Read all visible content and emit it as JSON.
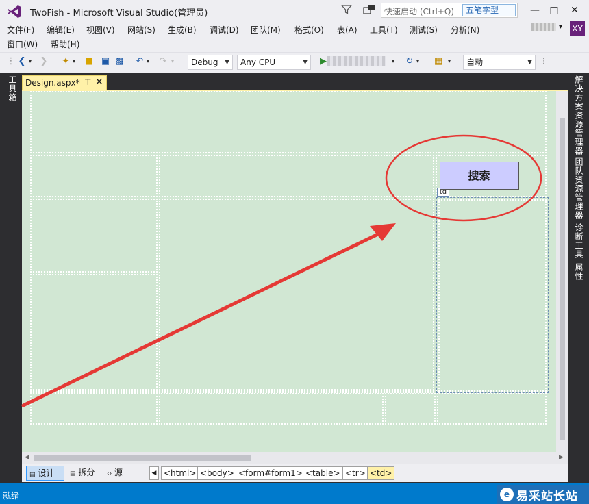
{
  "title_bar": {
    "title": "TwoFish - Microsoft Visual Studio(管理员)",
    "quick_launch_placeholder": "快速启动 (Ctrl+Q)",
    "ime_badge": "五笔字型"
  },
  "menu": {
    "row1": [
      "文件(F)",
      "编辑(E)",
      "视图(V)",
      "网站(S)",
      "生成(B)",
      "调试(D)",
      "团队(M)",
      "格式(O)",
      "表(A)",
      "工具(T)",
      "测试(S)",
      "分析(N)"
    ],
    "row2": [
      "窗口(W)",
      "帮助(H)"
    ],
    "avatar": "XY"
  },
  "toolbar": {
    "config": "Debug",
    "platform": "Any CPU",
    "zoom": "自动"
  },
  "left_strip": {
    "toolbox": "工具箱"
  },
  "right_strip": {
    "solution_explorer": "解决方案资源管理器",
    "team_explorer": "团队资源管理器",
    "diagnostics": "诊断工具",
    "properties": "属性"
  },
  "document": {
    "tab_label": "Design.aspx*",
    "search_button": "搜索",
    "td_tag": "td"
  },
  "bottom": {
    "views": [
      "设计",
      "拆分",
      "源"
    ],
    "breadcrumb": [
      "<html>",
      "<body>",
      "<form#form1>",
      "<table>",
      "<tr>",
      "<td>"
    ]
  },
  "status": {
    "text": "就绪",
    "watermark": "易采站长站",
    "accent": "#007acc",
    "annotation_color": "#e53935",
    "canvas_color": "#d1e7d3",
    "button_color": "#ccccff"
  }
}
